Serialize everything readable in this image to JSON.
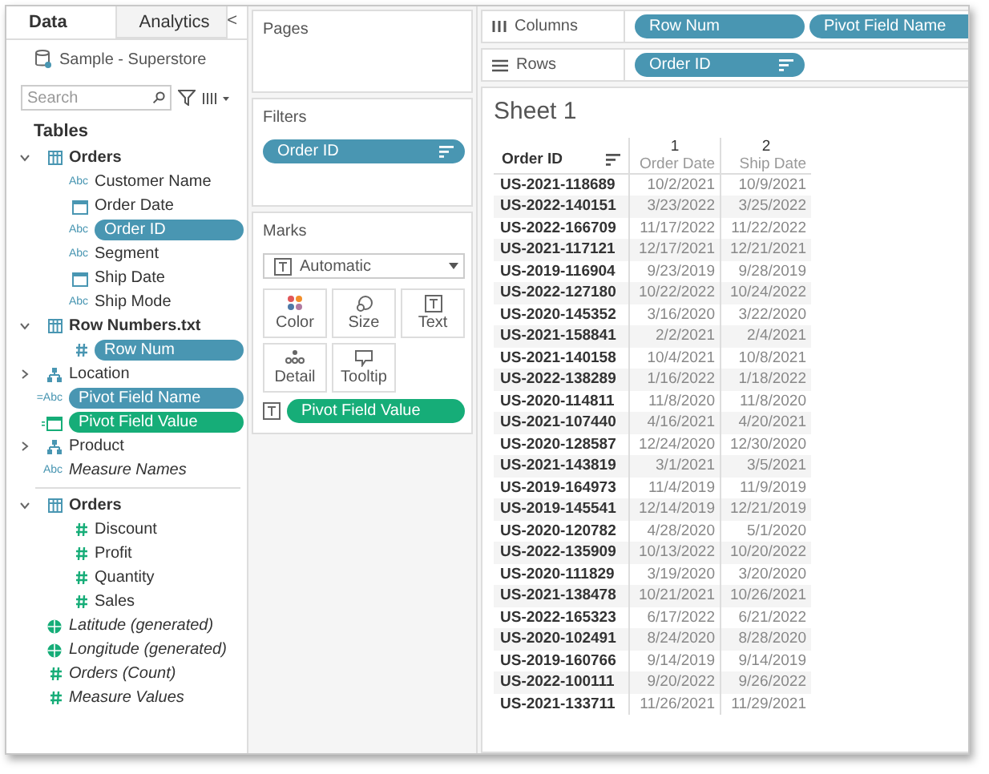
{
  "sidebar": {
    "tabs": [
      {
        "label": "Data",
        "selected": true
      },
      {
        "label": "Analytics",
        "selected": false
      }
    ],
    "collapse": "<",
    "data_source": "Sample - Superstore",
    "search": {
      "placeholder": "Search"
    },
    "heading": "Tables",
    "items": [
      {
        "kind": "table",
        "name": "Orders",
        "expanded": true,
        "children": [
          {
            "kind": "abc",
            "type_label": "Abc",
            "name": "Customer Name"
          },
          {
            "kind": "date",
            "name": "Order Date"
          },
          {
            "kind": "abc",
            "type_label": "Abc",
            "name": "Order ID",
            "in_use": true,
            "measure": false
          },
          {
            "kind": "abc",
            "type_label": "Abc",
            "name": "Segment"
          },
          {
            "kind": "date",
            "name": "Ship Date"
          },
          {
            "kind": "abc",
            "type_label": "Abc",
            "name": "Ship Mode"
          }
        ]
      },
      {
        "kind": "table",
        "name": "Row Numbers.txt",
        "expanded": true,
        "children": [
          {
            "kind": "number-dim",
            "name": "Row Num",
            "in_use": true,
            "measure": false
          }
        ]
      },
      {
        "kind": "hierarchy",
        "name": "Location",
        "expanded": false
      },
      {
        "kind": "abc",
        "type_label": "=Abc",
        "name": "Pivot Field Name",
        "in_use": true,
        "measure": false
      },
      {
        "kind": "date-calc",
        "name": "Pivot Field Value",
        "in_use": true,
        "measure": true
      },
      {
        "kind": "hierarchy",
        "name": "Product",
        "expanded": false
      },
      {
        "kind": "abc",
        "type_label": "Abc",
        "name": "Measure Names",
        "italic": true
      },
      {
        "kind": "divider"
      },
      {
        "kind": "table",
        "name": "Orders",
        "expanded": true,
        "children": [
          {
            "kind": "number",
            "name": "Discount"
          },
          {
            "kind": "number",
            "name": "Profit"
          },
          {
            "kind": "number",
            "name": "Quantity"
          },
          {
            "kind": "number",
            "name": "Sales"
          }
        ]
      },
      {
        "kind": "geo",
        "name": "Latitude (generated)",
        "italic": true
      },
      {
        "kind": "geo",
        "name": "Longitude (generated)",
        "italic": true
      },
      {
        "kind": "number",
        "name": "Orders (Count)",
        "italic": true
      },
      {
        "kind": "number",
        "name": "Measure Values",
        "italic": true
      }
    ]
  },
  "pages": {
    "title": "Pages"
  },
  "filters": {
    "title": "Filters",
    "pills": [
      {
        "label": "Order ID",
        "measure": false,
        "sorted": true
      }
    ]
  },
  "marks": {
    "title": "Marks",
    "type": "Automatic",
    "buttons": [
      {
        "kind": "color",
        "label": "Color"
      },
      {
        "kind": "size",
        "label": "Size"
      },
      {
        "kind": "text",
        "label": "Text"
      },
      {
        "kind": "detail",
        "label": "Detail"
      },
      {
        "kind": "tooltip",
        "label": "Tooltip"
      }
    ],
    "fields": [
      {
        "kind": "text",
        "label": "Pivot Field Value",
        "measure": true
      }
    ]
  },
  "shelves": [
    {
      "kind": "columns",
      "label": "Columns",
      "pills": [
        {
          "label": "Row Num",
          "measure": false,
          "sorted": false
        },
        {
          "label": "Pivot Field Name",
          "measure": false,
          "sorted": false
        }
      ]
    },
    {
      "kind": "rows",
      "label": "Rows",
      "pills": [
        {
          "label": "Order ID",
          "measure": false,
          "sorted": true
        }
      ]
    }
  ],
  "sheet": {
    "title": "Sheet 1",
    "row_header": "Order ID",
    "column_groups": [
      {
        "label": "1",
        "sub": "Order Date"
      },
      {
        "label": "2",
        "sub": "Ship Date"
      }
    ],
    "rows": [
      [
        "US-2021-118689",
        "10/2/2021",
        "10/9/2021"
      ],
      [
        "US-2022-140151",
        "3/23/2022",
        "3/25/2022"
      ],
      [
        "US-2022-166709",
        "11/17/2022",
        "11/22/2022"
      ],
      [
        "US-2021-117121",
        "12/17/2021",
        "12/21/2021"
      ],
      [
        "US-2019-116904",
        "9/23/2019",
        "9/28/2019"
      ],
      [
        "US-2022-127180",
        "10/22/2022",
        "10/24/2022"
      ],
      [
        "US-2020-145352",
        "3/16/2020",
        "3/22/2020"
      ],
      [
        "US-2021-158841",
        "2/2/2021",
        "2/4/2021"
      ],
      [
        "US-2021-140158",
        "10/4/2021",
        "10/8/2021"
      ],
      [
        "US-2022-138289",
        "1/16/2022",
        "1/18/2022"
      ],
      [
        "US-2020-114811",
        "11/8/2020",
        "11/8/2020"
      ],
      [
        "US-2021-107440",
        "4/16/2021",
        "4/20/2021"
      ],
      [
        "US-2020-128587",
        "12/24/2020",
        "12/30/2020"
      ],
      [
        "US-2021-143819",
        "3/1/2021",
        "3/5/2021"
      ],
      [
        "US-2019-164973",
        "11/4/2019",
        "11/9/2019"
      ],
      [
        "US-2019-145541",
        "12/14/2019",
        "12/21/2019"
      ],
      [
        "US-2020-120782",
        "4/28/2020",
        "5/1/2020"
      ],
      [
        "US-2022-135909",
        "10/13/2022",
        "10/20/2022"
      ],
      [
        "US-2020-111829",
        "3/19/2020",
        "3/20/2020"
      ],
      [
        "US-2021-138478",
        "10/21/2021",
        "10/26/2021"
      ],
      [
        "US-2022-165323",
        "6/17/2022",
        "6/21/2022"
      ],
      [
        "US-2020-102491",
        "8/24/2020",
        "8/28/2020"
      ],
      [
        "US-2019-160766",
        "9/14/2019",
        "9/14/2019"
      ],
      [
        "US-2022-100111",
        "9/20/2022",
        "9/26/2022"
      ],
      [
        "US-2021-133711",
        "11/26/2021",
        "11/29/2021"
      ]
    ]
  }
}
